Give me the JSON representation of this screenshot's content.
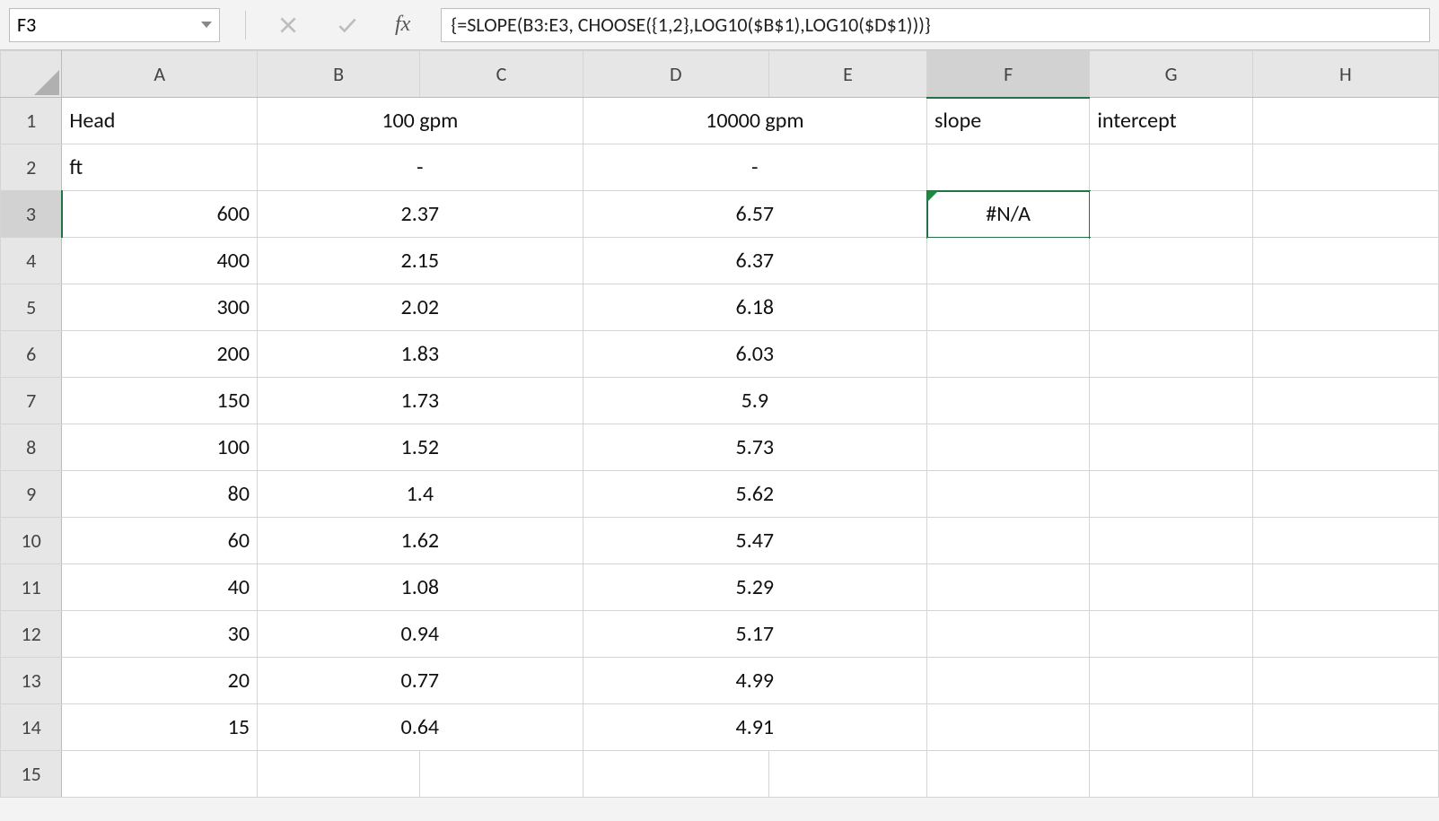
{
  "namebox": {
    "value": "F3"
  },
  "formula_bar": {
    "label": "fx",
    "value": "{=SLOPE(B3:E3, CHOOSE({1,2},LOG10($B$1),LOG10($D$1)))}"
  },
  "columns": [
    "A",
    "B",
    "C",
    "D",
    "E",
    "F",
    "G",
    "H"
  ],
  "row_headers": [
    "1",
    "2",
    "3",
    "4",
    "5",
    "6",
    "7",
    "8",
    "9",
    "10",
    "11",
    "12",
    "13",
    "14",
    "15"
  ],
  "selected": {
    "col": "F",
    "row": "3"
  },
  "error_indicator": {
    "glyph": "!"
  },
  "cells": {
    "A1": {
      "v": "Head",
      "a": "left"
    },
    "B1": {
      "v": "100 gpm",
      "a": "center",
      "merge": "C1"
    },
    "D1": {
      "v": "10000 gpm",
      "a": "center",
      "merge": "E1"
    },
    "F1": {
      "v": "slope",
      "a": "left"
    },
    "G1": {
      "v": "intercept",
      "a": "left"
    },
    "A2": {
      "v": "ft",
      "a": "left"
    },
    "B2": {
      "v": "-",
      "a": "center",
      "merge": "C2"
    },
    "D2": {
      "v": "-",
      "a": "center",
      "merge": "E2"
    },
    "A3": {
      "v": "600",
      "a": "right"
    },
    "B3": {
      "v": "2.37",
      "a": "center",
      "merge": "C3"
    },
    "D3": {
      "v": "6.57",
      "a": "center",
      "merge": "E3"
    },
    "F3": {
      "v": "#N/A",
      "a": "center",
      "sel": true,
      "err": true
    },
    "A4": {
      "v": "400",
      "a": "right"
    },
    "B4": {
      "v": "2.15",
      "a": "center",
      "merge": "C4"
    },
    "D4": {
      "v": "6.37",
      "a": "center",
      "merge": "E4"
    },
    "A5": {
      "v": "300",
      "a": "right"
    },
    "B5": {
      "v": "2.02",
      "a": "center",
      "merge": "C5"
    },
    "D5": {
      "v": "6.18",
      "a": "center",
      "merge": "E5"
    },
    "A6": {
      "v": "200",
      "a": "right"
    },
    "B6": {
      "v": "1.83",
      "a": "center",
      "merge": "C6"
    },
    "D6": {
      "v": "6.03",
      "a": "center",
      "merge": "E6"
    },
    "A7": {
      "v": "150",
      "a": "right"
    },
    "B7": {
      "v": "1.73",
      "a": "center",
      "merge": "C7"
    },
    "D7": {
      "v": "5.9",
      "a": "center",
      "merge": "E7"
    },
    "A8": {
      "v": "100",
      "a": "right"
    },
    "B8": {
      "v": "1.52",
      "a": "center",
      "merge": "C8"
    },
    "D8": {
      "v": "5.73",
      "a": "center",
      "merge": "E8"
    },
    "A9": {
      "v": "80",
      "a": "right"
    },
    "B9": {
      "v": "1.4",
      "a": "center",
      "merge": "C9"
    },
    "D9": {
      "v": "5.62",
      "a": "center",
      "merge": "E9"
    },
    "A10": {
      "v": "60",
      "a": "right"
    },
    "B10": {
      "v": "1.62",
      "a": "center",
      "merge": "C10"
    },
    "D10": {
      "v": "5.47",
      "a": "center",
      "merge": "E10"
    },
    "A11": {
      "v": "40",
      "a": "right"
    },
    "B11": {
      "v": "1.08",
      "a": "center",
      "merge": "C11"
    },
    "D11": {
      "v": "5.29",
      "a": "center",
      "merge": "E11"
    },
    "A12": {
      "v": "30",
      "a": "right"
    },
    "B12": {
      "v": "0.94",
      "a": "center",
      "merge": "C12"
    },
    "D12": {
      "v": "5.17",
      "a": "center",
      "merge": "E12"
    },
    "A13": {
      "v": "20",
      "a": "right"
    },
    "B13": {
      "v": "0.77",
      "a": "center",
      "merge": "C13"
    },
    "D13": {
      "v": "4.99",
      "a": "center",
      "merge": "E13"
    },
    "A14": {
      "v": "15",
      "a": "right"
    },
    "B14": {
      "v": "0.64",
      "a": "center",
      "merge": "C14"
    },
    "D14": {
      "v": "4.91",
      "a": "center",
      "merge": "E14"
    }
  }
}
